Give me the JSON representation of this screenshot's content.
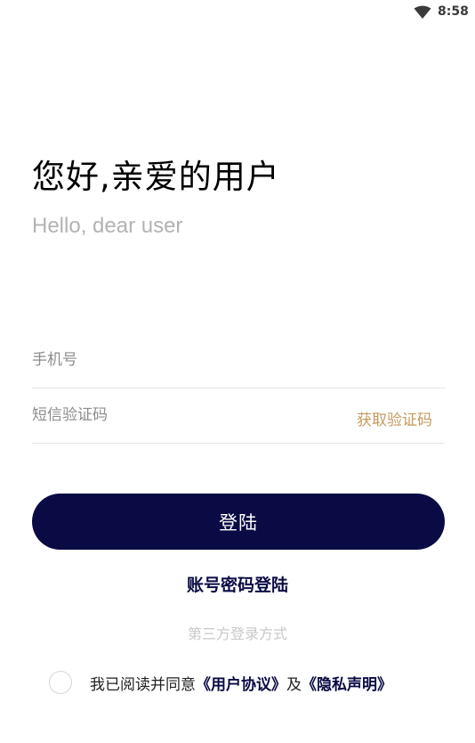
{
  "status_bar": {
    "time": "8:58",
    "wifi_icon": "wifi-icon"
  },
  "greeting": {
    "title": "您好,亲爱的用户",
    "subtitle": "Hello, dear user"
  },
  "form": {
    "phone_placeholder": "手机号",
    "phone_value": "",
    "code_placeholder": "短信验证码",
    "code_value": "",
    "get_code_label": "获取验证码"
  },
  "actions": {
    "login_label": "登陆",
    "account_login_label": "账号密码登陆",
    "third_party_label": "第三方登录方式"
  },
  "agreement": {
    "checked": false,
    "prefix": "我已阅读并同意",
    "user_agreement": "《用户协议》",
    "conjunction": "及",
    "privacy_policy": "《隐私声明》"
  },
  "colors": {
    "primary": "#0a0a45",
    "accent": "#c49a5d",
    "placeholder": "#8c8c8c",
    "subtle": "#b3b3b3"
  }
}
